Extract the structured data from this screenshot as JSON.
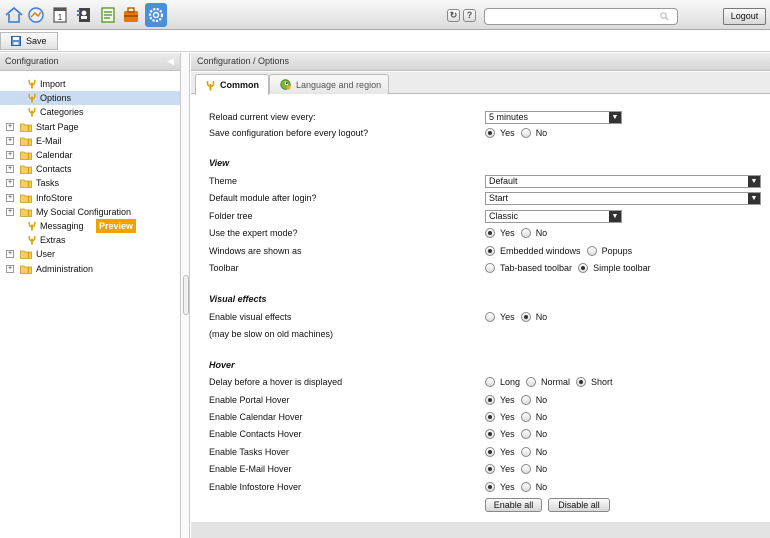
{
  "toolbar": {
    "apps": [
      "home-icon",
      "portal-icon",
      "calendar-icon",
      "contacts-icon",
      "tasks-icon",
      "infostore-icon",
      "configuration-icon"
    ],
    "refresh_symbol": "↻",
    "help_symbol": "?",
    "search_placeholder": "",
    "logout_label": "Logout"
  },
  "savebar": {
    "save_label": "Save"
  },
  "left": {
    "title": "Configuration",
    "items": [
      {
        "label": "Import",
        "expandable": false
      },
      {
        "label": "Options",
        "expandable": false,
        "selected": true
      },
      {
        "label": "Categories",
        "expandable": false
      },
      {
        "label": "Start Page",
        "expandable": true
      },
      {
        "label": "E-Mail",
        "expandable": true
      },
      {
        "label": "Calendar",
        "expandable": true
      },
      {
        "label": "Contacts",
        "expandable": true
      },
      {
        "label": "Tasks",
        "expandable": true
      },
      {
        "label": "InfoStore",
        "expandable": true
      },
      {
        "label": "My Social Configuration",
        "expandable": true
      },
      {
        "label": "Messaging",
        "expandable": false,
        "badge": "Preview"
      },
      {
        "label": "Extras",
        "expandable": false
      },
      {
        "label": "User",
        "expandable": true
      },
      {
        "label": "Administration",
        "expandable": true
      }
    ]
  },
  "right": {
    "breadcrumb": "Configuration / Options",
    "tabs": [
      {
        "label": "Common",
        "active": true
      },
      {
        "label": "Language and region",
        "active": false
      }
    ],
    "form": {
      "reload_label": "Reload current view every:",
      "reload_value": "5 minutes",
      "save_before_logout_label": "Save configuration before every logout?",
      "section_view": "View",
      "theme_label": "Theme",
      "theme_value": "Default",
      "default_module_label": "Default module after login?",
      "default_module_value": "Start",
      "folder_tree_label": "Folder tree",
      "folder_tree_value": "Classic",
      "expert_mode_label": "Use the expert mode?",
      "windows_label": "Windows are shown as",
      "windows_opt1": "Embedded windows",
      "windows_opt2": "Popups",
      "toolbar_label": "Toolbar",
      "toolbar_opt1": "Tab-based toolbar",
      "toolbar_opt2": "Simple toolbar",
      "section_visual": "Visual effects",
      "visual_label": "Enable visual effects",
      "visual_note": "(may be slow on old machines)",
      "section_hover": "Hover",
      "hover_delay_label": "Delay before a hover is displayed",
      "hover_long": "Long",
      "hover_normal": "Normal",
      "hover_short": "Short",
      "hover_portal_label": "Enable Portal Hover",
      "hover_calendar_label": "Enable Calendar Hover",
      "hover_contacts_label": "Enable Contacts Hover",
      "hover_tasks_label": "Enable Tasks Hover",
      "hover_email_label": "Enable E-Mail Hover",
      "hover_infostore_label": "Enable Infostore Hover",
      "yes": "Yes",
      "no": "No",
      "enable_all_label": "Enable all",
      "disable_all_label": "Disable all"
    }
  },
  "colors": {
    "accent": "#4a90d9",
    "selection": "#c9dcf1",
    "preview_badge": "#f5a000"
  }
}
